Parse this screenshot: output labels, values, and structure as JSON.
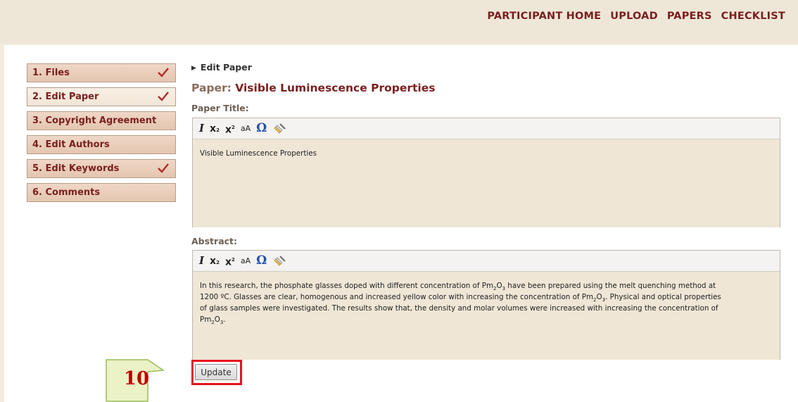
{
  "nav": {
    "participant_home": "PARTICIPANT HOME",
    "upload": "UPLOAD",
    "papers": "PAPERS",
    "checklist": "CHECKLIST"
  },
  "steps": [
    {
      "label": "1. Files",
      "checked": true
    },
    {
      "label": "2. Edit Paper",
      "checked": true
    },
    {
      "label": "3. Copyright Agreement",
      "checked": false
    },
    {
      "label": "4. Edit Authors",
      "checked": false
    },
    {
      "label": "5. Edit Keywords",
      "checked": true
    },
    {
      "label": "6. Comments",
      "checked": false
    }
  ],
  "breadcrumb": "Edit Paper",
  "paper": {
    "prefix": "Paper: ",
    "name": "Visible Luminescence Properties"
  },
  "title_field": {
    "label": "Paper Title:",
    "value": "Visible Luminescence Properties"
  },
  "abstract_field": {
    "label": "Abstract:",
    "line1a": "In this research, the phosphate glasses doped with different concentration of Pm",
    "line1b": "O",
    "line1c": " have been prepared using the melt quenching method at",
    "line2a": "1200 ºC. Glasses are clear, homogenous and increased yellow color with increasing the concentration of Pm",
    "line2b": "O",
    "line2c": ". Physical and optical properties",
    "line3": "of glass samples were investigated. The results show that, the density and molar volumes were increased with increasing the concentration of",
    "line4a": "Pm",
    "line4b": "O",
    "line4c": ".",
    "sub2": "2",
    "sub3": "3"
  },
  "toolbar": {
    "italic": "I",
    "subscript": "x",
    "superscript": "x",
    "sub_mark": "2",
    "sup_mark": "2",
    "change_case": "aA",
    "special_char": "Ω"
  },
  "update_button": "Update",
  "callout_number": "10",
  "colors": {
    "accent": "#7a1f1f",
    "highlight": "#e8121c",
    "callout_fill": "#ebf2c6",
    "callout_border": "#9bbb59",
    "check": "#b02a2a"
  }
}
